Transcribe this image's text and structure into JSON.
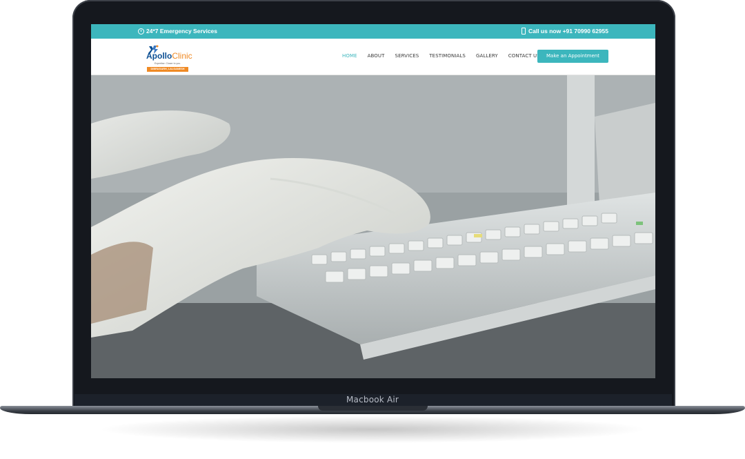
{
  "device": {
    "label": "Macbook Air"
  },
  "website": {
    "topbar": {
      "emergency_text": "24*7 Emergency Services",
      "call_text": "Call us now +91 70990 62955",
      "bg_color": "#3cb6bd"
    },
    "logo": {
      "brand_part1": "Apollo",
      "brand_part2": "Clinic",
      "tagline": "Expertise. Closer to you.",
      "location": "DIBRUGARH, LALGANESH"
    },
    "nav": {
      "items": [
        {
          "label": "HOME",
          "active": true
        },
        {
          "label": "ABOUT",
          "active": false
        },
        {
          "label": "SERVICES",
          "active": false
        },
        {
          "label": "TESTIMONIALS",
          "active": false
        },
        {
          "label": "GALLERY",
          "active": false
        },
        {
          "label": "CONTACT US",
          "active": false
        }
      ],
      "cta_label": "Make an Appointment"
    },
    "hero": {
      "image": "gloved hands typing on medical equipment keyboard"
    }
  }
}
